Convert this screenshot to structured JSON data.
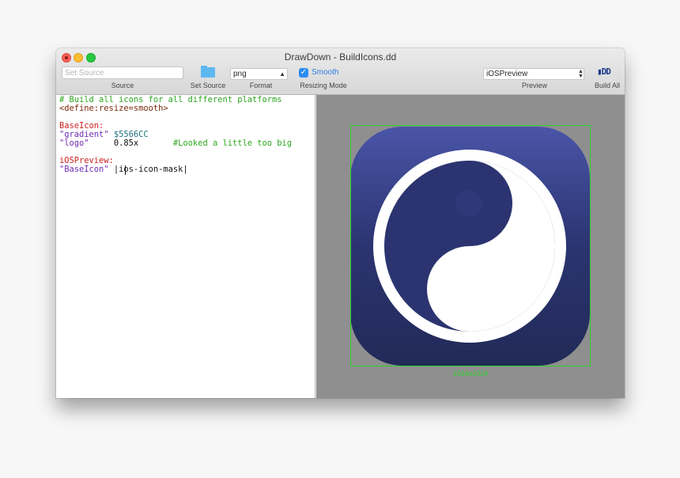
{
  "window": {
    "title": "DrawDown - BuildIcons.dd"
  },
  "toolbar": {
    "source_placeholder": "Set Source",
    "source_caption": "Source",
    "set_source_caption": "Set Source",
    "format_value": "png",
    "format_caption": "Format",
    "smooth_label": "Smooth",
    "smooth_checked": true,
    "resizing_caption": "Resizing Mode",
    "preview_value": "iOSPreview",
    "preview_caption": "Preview",
    "build_all_icon": "DD",
    "build_all_caption": "Build All"
  },
  "editor": {
    "lines": [
      "# Build all icons for all different platforms",
      "<define:resize=smooth>",
      "",
      "BaseIcon:",
      "\"gradient\"",
      "$5566CC",
      "\"logo\"",
      "0.85x",
      "#Looked a little too big",
      "",
      "iOSPreview:",
      "\"BaseIcon\"",
      "|ios-icon-mask|"
    ]
  },
  "preview": {
    "size_label": "1024x1024",
    "gradient_top": "#5566CC",
    "gradient_bottom": "#222a55",
    "bounds_color": "#2bd12b",
    "icon": "yin-yang-icon"
  }
}
